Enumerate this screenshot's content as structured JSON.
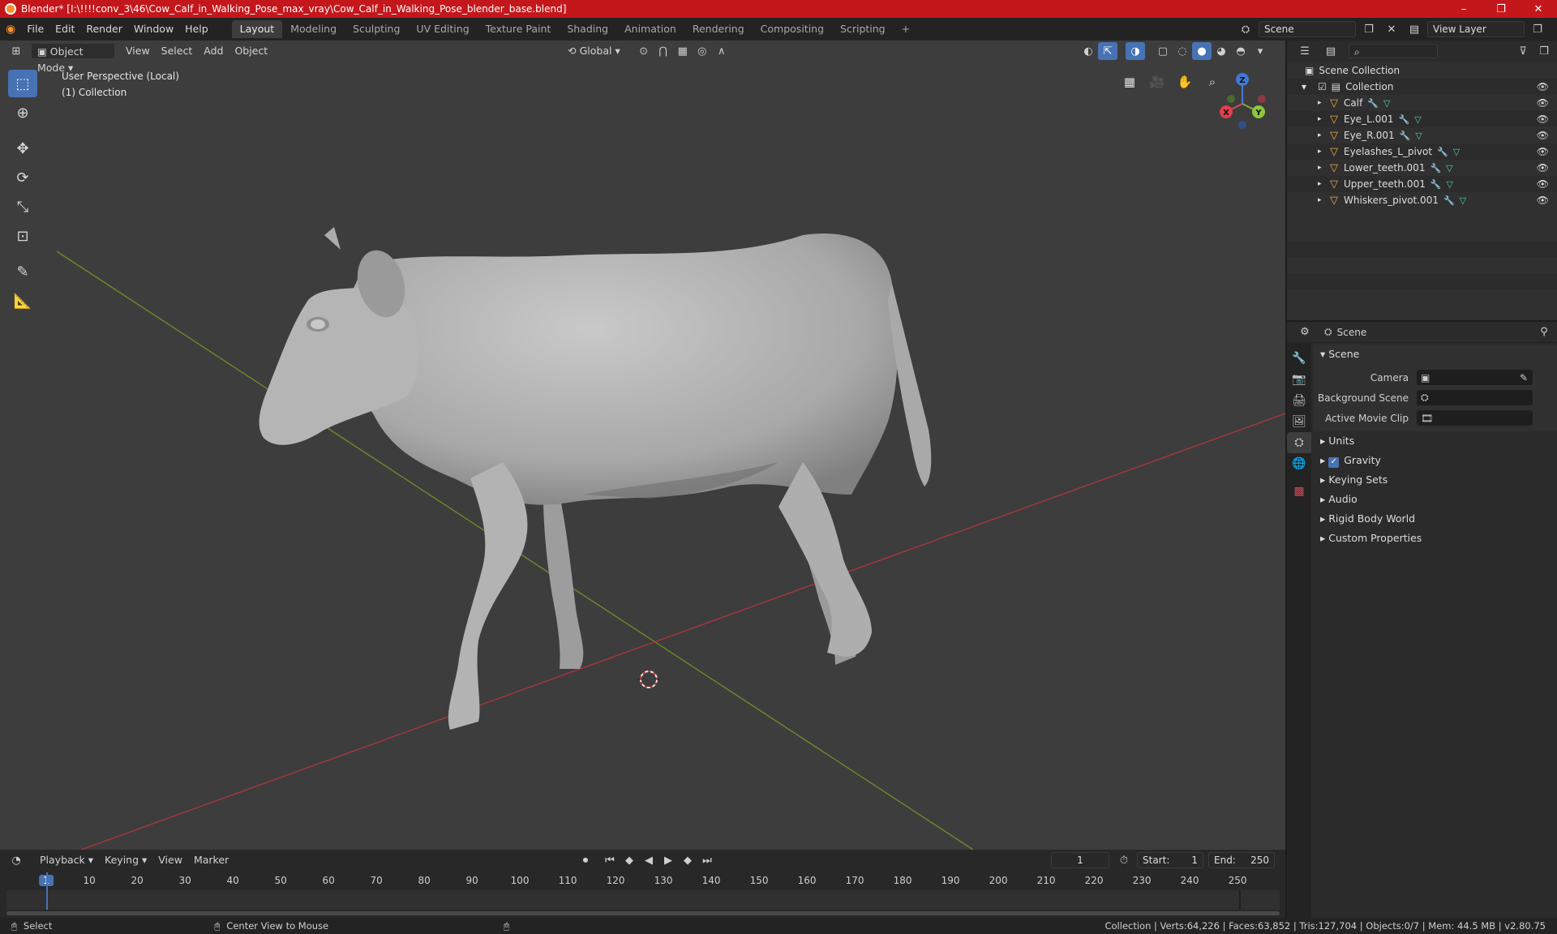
{
  "window": {
    "title": "Blender* [I:\\!!!!conv_3\\46\\Cow_Calf_in_Walking_Pose_max_vray\\Cow_Calf_in_Walking_Pose_blender_base.blend]",
    "minimize": "–",
    "maximize": "❐",
    "close": "✕"
  },
  "menu": {
    "items": [
      "File",
      "Edit",
      "Render",
      "Window",
      "Help"
    ],
    "workspaces": [
      "Layout",
      "Modeling",
      "Sculpting",
      "UV Editing",
      "Texture Paint",
      "Shading",
      "Animation",
      "Rendering",
      "Compositing",
      "Scripting"
    ],
    "active_workspace": "Layout",
    "add_workspace": "+",
    "scene_name": "Scene",
    "view_layer": "View Layer"
  },
  "viewport": {
    "mode": "Object Mode",
    "menus": [
      "View",
      "Select",
      "Add",
      "Object"
    ],
    "transform_orientation": "Global",
    "info_line1": "User Perspective (Local)",
    "info_line2": "(1) Collection",
    "gizmo": {
      "x": "X",
      "y": "Y",
      "z": "Z"
    }
  },
  "timeline": {
    "menus": [
      "Playback",
      "Keying",
      "View",
      "Marker"
    ],
    "current_frame": "1",
    "start_label": "Start:",
    "start": "1",
    "end_label": "End:",
    "end": "250",
    "ticks": [
      "1",
      "10",
      "20",
      "30",
      "40",
      "50",
      "60",
      "70",
      "80",
      "90",
      "100",
      "110",
      "120",
      "130",
      "140",
      "150",
      "160",
      "170",
      "180",
      "190",
      "200",
      "210",
      "220",
      "230",
      "240",
      "250"
    ]
  },
  "status": {
    "select": "Select",
    "center_view": "Center View to Mouse",
    "stats": "Collection | Verts:64,226 | Faces:63,852 | Tris:127,704 | Objects:0/7 | Mem: 44.5 MB | v2.80.75"
  },
  "outliner": {
    "root": "Scene Collection",
    "collection": "Collection",
    "objects": [
      "Calf",
      "Eye_L.001",
      "Eye_R.001",
      "Eyelashes_L_pivot",
      "Lower_teeth.001",
      "Upper_teeth.001",
      "Whiskers_pivot.001"
    ]
  },
  "properties": {
    "context": "Scene",
    "section": "Scene",
    "camera_label": "Camera",
    "background_scene_label": "Background Scene",
    "active_movie_clip_label": "Active Movie Clip",
    "panels": [
      "Units",
      "Gravity",
      "Keying Sets",
      "Audio",
      "Rigid Body World",
      "Custom Properties"
    ],
    "gravity_checked": true
  }
}
